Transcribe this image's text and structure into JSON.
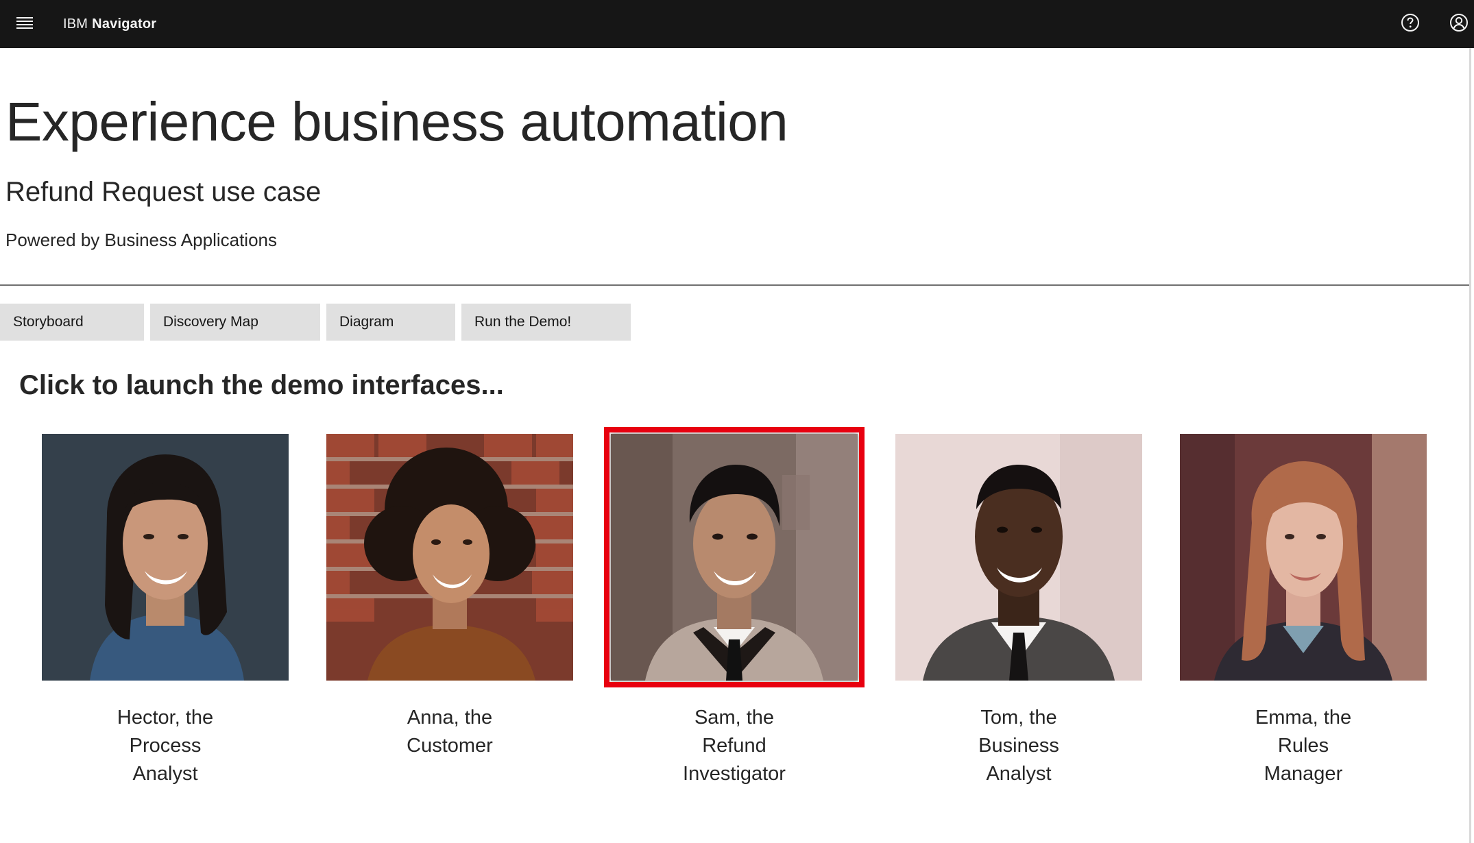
{
  "header": {
    "brand_prefix": "IBM",
    "brand_name": "Navigator",
    "icons": [
      "menu-icon",
      "help-icon",
      "user-icon"
    ]
  },
  "hero": {
    "title": "Experience business automation",
    "subtitle": "Refund Request use case",
    "powered_by": "Powered by Business Applications"
  },
  "tabs": [
    {
      "label": "Storyboard"
    },
    {
      "label": "Discovery Map"
    },
    {
      "label": "Diagram"
    },
    {
      "label": "Run the Demo!"
    }
  ],
  "launch": {
    "heading": "Click to launch the demo interfaces..."
  },
  "personas": [
    {
      "lines": [
        "Hector, the",
        "Process",
        "Analyst"
      ],
      "selected": false
    },
    {
      "lines": [
        "Anna, the",
        "Customer"
      ],
      "selected": false
    },
    {
      "lines": [
        "Sam, the",
        "Refund",
        "Investigator"
      ],
      "selected": true
    },
    {
      "lines": [
        "Tom, the",
        "Business",
        "Analyst"
      ],
      "selected": false
    },
    {
      "lines": [
        "Emma, the",
        "Rules",
        "Manager"
      ],
      "selected": false
    }
  ],
  "colors": {
    "topbar": "#161616",
    "tab_bg": "#e0e0e0",
    "selection_border": "#e8000f"
  }
}
